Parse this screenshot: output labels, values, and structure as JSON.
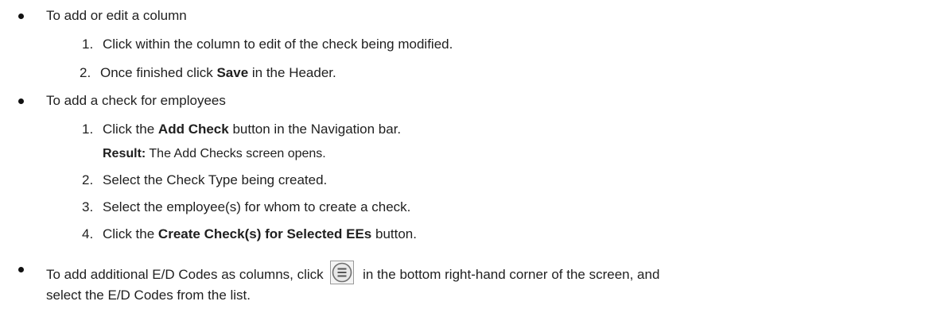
{
  "bullets": [
    {
      "text": "To add or edit a column",
      "steps": [
        {
          "num": "1.",
          "parts": [
            {
              "t": "Click within the column to edit of the check being modified.",
              "b": false
            }
          ]
        },
        {
          "num": "2.",
          "parts": [
            {
              "t": "Once finished click ",
              "b": false
            },
            {
              "t": "Save",
              "b": true
            },
            {
              "t": " in the Header.",
              "b": false
            }
          ]
        }
      ]
    },
    {
      "text": "To add a check for employees",
      "steps": [
        {
          "num": "1.",
          "parts": [
            {
              "t": "Click the ",
              "b": false
            },
            {
              "t": "Add Check",
              "b": true
            },
            {
              "t": " button in the Navigation bar.",
              "b": false
            }
          ]
        },
        {
          "num": "2.",
          "parts": [
            {
              "t": "Select the Check Type being created.",
              "b": false
            }
          ]
        },
        {
          "num": "3.",
          "parts": [
            {
              "t": "Select the employee(s) for whom to create a check.",
              "b": false
            }
          ]
        },
        {
          "num": "4.",
          "parts": [
            {
              "t": "Click the ",
              "b": false
            },
            {
              "t": "Create Check(s) for Selected EEs",
              "b": true
            },
            {
              "t": " button.",
              "b": false
            }
          ]
        }
      ],
      "result": {
        "label": "Result:",
        "text": " The Add Checks screen opens."
      }
    },
    {
      "line1_before": "To add additional E/D Codes as columns, click ",
      "icon": "menu-circle-icon",
      "line1_after": " in the bottom right-hand corner of the screen, and",
      "line2": "select the E/D Codes from the list."
    }
  ]
}
